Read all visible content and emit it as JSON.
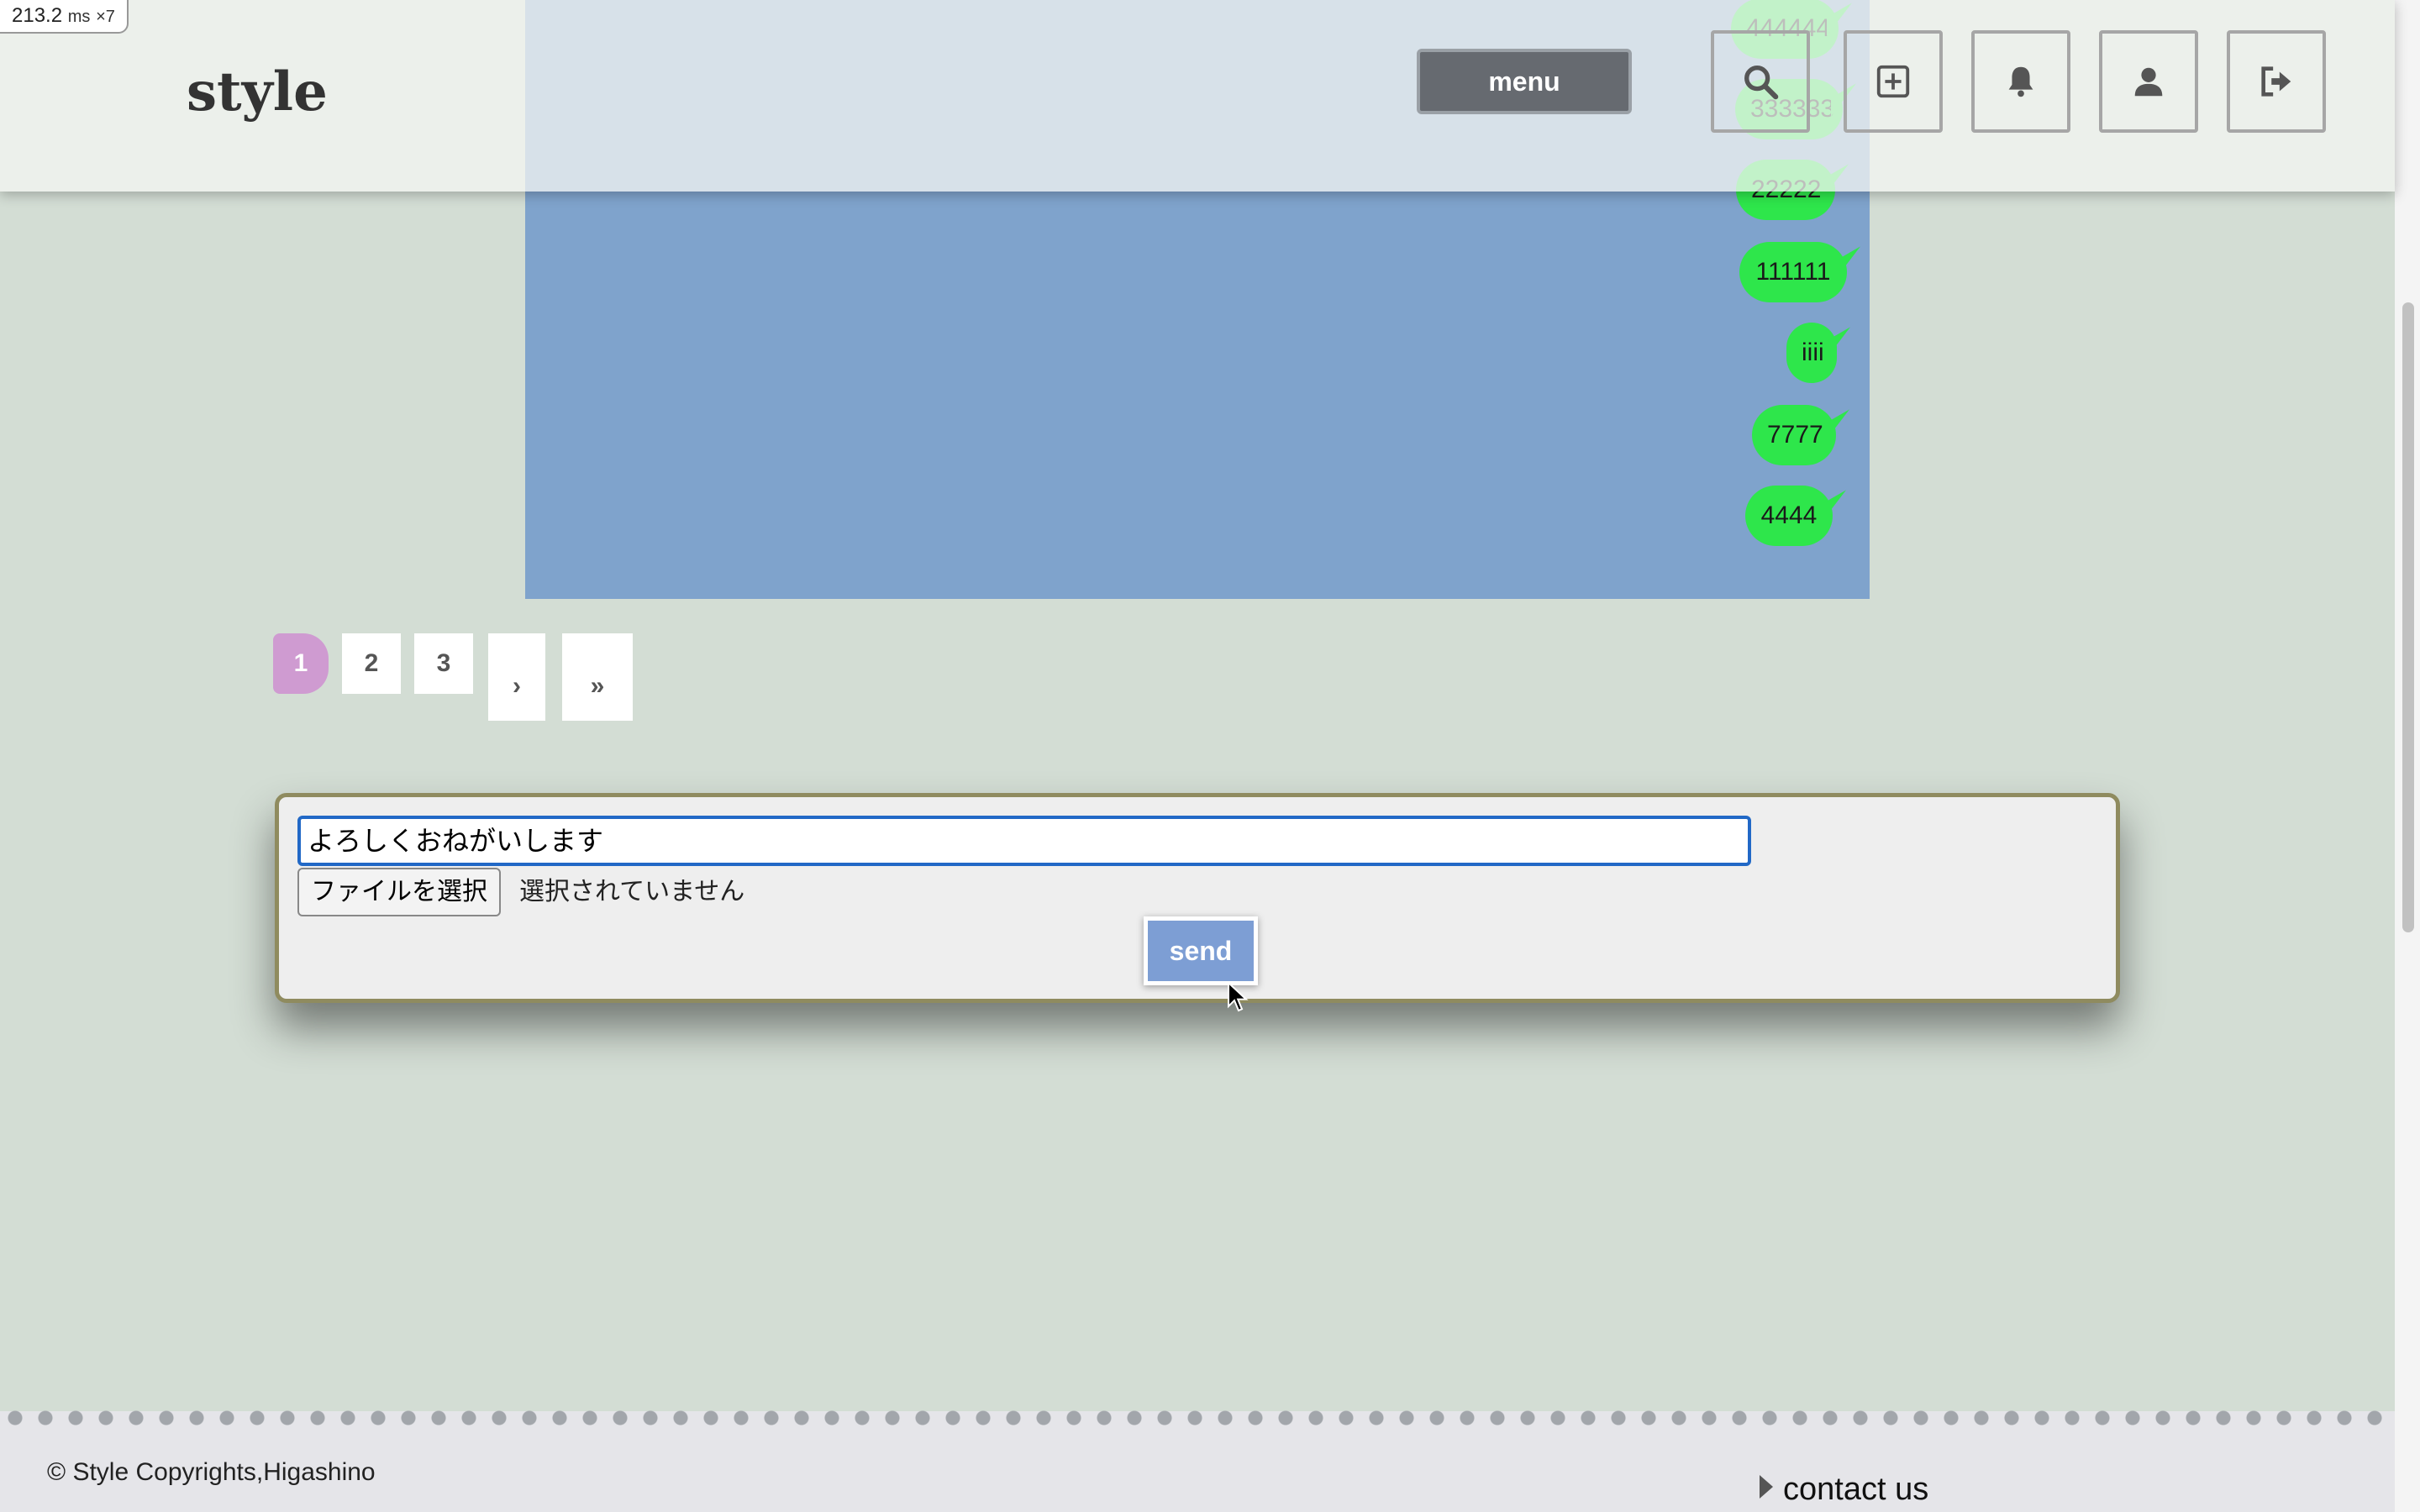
{
  "perf_badge": {
    "value": "213.2",
    "unit": "ms",
    "multiplier": "×7"
  },
  "header": {
    "logo": "style",
    "menu_label": "menu",
    "icons": [
      "search-icon",
      "plus-square-icon",
      "bell-icon",
      "user-icon",
      "sign-out-icon"
    ]
  },
  "chat": {
    "messages": [
      "444444",
      "333333",
      "22222",
      "111111",
      "iiii",
      "7777",
      "4444"
    ],
    "panel_color": "#7fa3cc",
    "bubble_color": "#2ee64b"
  },
  "pagination": {
    "pages": [
      "1",
      "2",
      "3"
    ],
    "current_page": "1",
    "next_label": "›",
    "last_label": "»"
  },
  "message_form": {
    "input_value": "よろしくおねがいします",
    "file_button_label": "ファイルを選択",
    "file_status": "選択されていません",
    "send_label": "send"
  },
  "footer": {
    "copyright": "© Style Copyrights,Higashino",
    "contact_label": "contact us"
  }
}
